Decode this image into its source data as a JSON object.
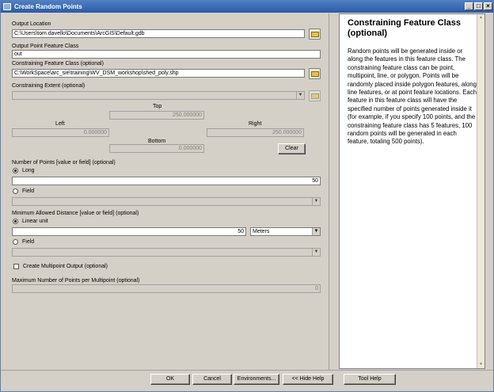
{
  "window": {
    "title": "Create Random Points"
  },
  "controls": {
    "minimize": "_",
    "maximize": "□",
    "close": "×"
  },
  "fields": {
    "output_location": {
      "label": "Output Location",
      "value": "C:\\Users\\tom.davello\\Documents\\ArcGIS\\Default.gdb"
    },
    "output_fc": {
      "label": "Output Point Feature Class",
      "value": "out"
    },
    "constraining_fc": {
      "label": "Constraining Feature Class (optional)",
      "value": "C:\\WorkSpace\\arc_sie\\training\\WV_DSM_workshop\\shed_poly.shp"
    },
    "constraining_extent": {
      "label": "Constraining Extent (optional)",
      "value": ""
    },
    "extent": {
      "top_label": "Top",
      "top": "250.000000",
      "left_label": "Left",
      "left": "0.000000",
      "right_label": "Right",
      "right": "250.000000",
      "bottom_label": "Bottom",
      "bottom": "0.000000",
      "clear": "Clear"
    },
    "num_points": {
      "label": "Number of Points [value or field] (optional)",
      "long_label": "Long",
      "long_value": "50",
      "field_label": "Field"
    },
    "min_distance": {
      "label": "Minimum Allowed Distance [value or field] (optional)",
      "linear_label": "Linear unit",
      "linear_value": "50",
      "unit": "Meters",
      "field_label": "Field"
    },
    "multipoint": {
      "label": "Create Multipoint Output (optional)"
    },
    "max_points": {
      "label": "Maximum Number of Points per Multipoint (optional)",
      "value": "0"
    }
  },
  "buttons": {
    "ok": "OK",
    "cancel": "Cancel",
    "environments": "Environments...",
    "hide_help": "<< Hide Help",
    "tool_help": "Tool Help"
  },
  "help": {
    "title": "Constraining Feature Class (optional)",
    "body": "Random points will be generated inside or along the features in this feature class. The constraining feature class can be point, multipoint, line, or polygon. Points will be randomly placed inside polygon features, along line features, or at point feature locations. Each feature in this feature class will have the specified number of points generated inside it (for example, if you specify 100 points, and the constraining feature class has 5 features, 100 random points will be generated in each feature, totaling 500 points)."
  }
}
